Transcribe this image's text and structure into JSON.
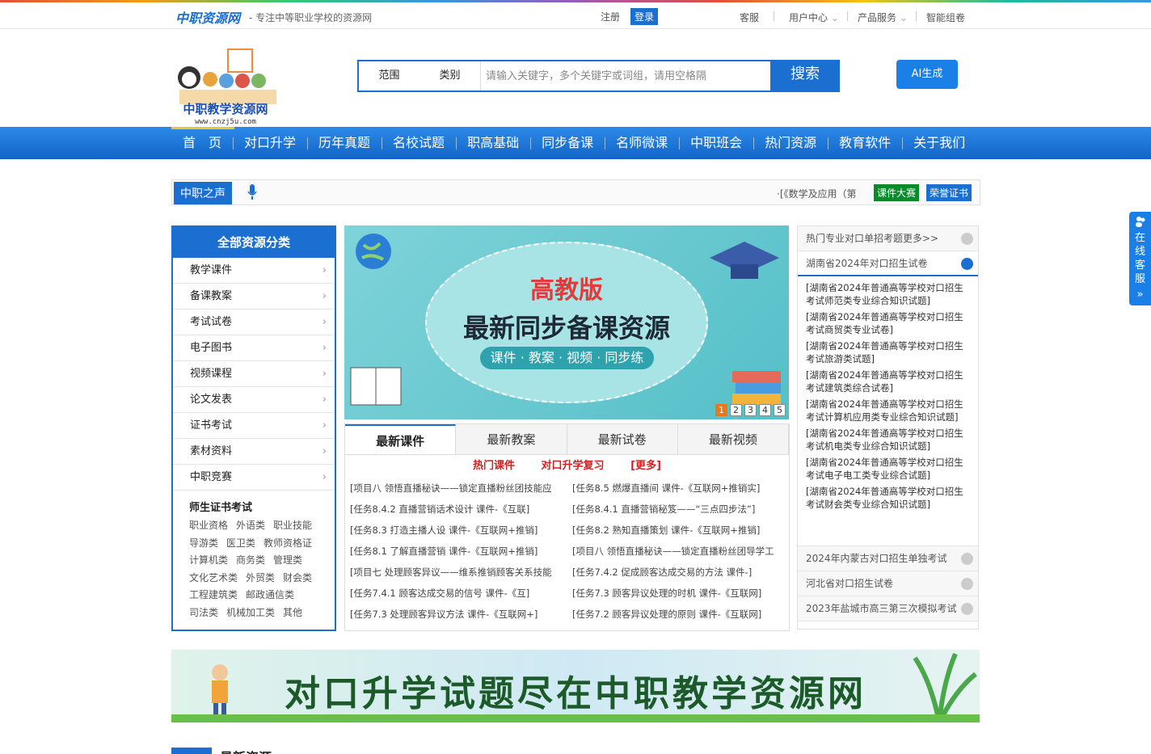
{
  "topbar": {
    "logo": "中职资源网",
    "slogan": "- 专注中等职业学校的资源网",
    "register": "注册",
    "login": "登录",
    "service": "客服",
    "user_center": "用户中心",
    "products": "产品服务",
    "smart_exam": "智能组卷"
  },
  "header": {
    "logo_text": "中职教学资源网",
    "logo_url": "www.cnzj5u.com",
    "scope": "范围",
    "category": "类别",
    "search_placeholder": "请输入关键字，多个关键字或词组，请用空格隔",
    "search_button": "搜索",
    "ai_button": "AI生成"
  },
  "nav": [
    "首　页",
    "对口升学",
    "历年真题",
    "名校试题",
    "职高基础",
    "同步备课",
    "名师微课",
    "中职班会",
    "热门资源",
    "教育软件",
    "关于我们"
  ],
  "voice": {
    "title": "中职之声",
    "ticker": "·[《数学及应用（第",
    "badge1": "课件大赛",
    "badge2": "荣誉证书"
  },
  "categories": {
    "title": "全部资源分类",
    "items": [
      "教学课件",
      "备课教案",
      "考试试卷",
      "电子图书",
      "视频课程",
      "论文发表",
      "证书考试",
      "素材资料",
      "中职竞赛"
    ],
    "sub_title": "师生证书考试",
    "sub_items": [
      "职业资格",
      "外语类",
      "职业技能",
      "导游类",
      "医卫类",
      "教师资格证",
      "计算机类",
      "商务类",
      "管理类",
      "文化艺术类",
      "外贸类",
      "财会类",
      "工程建筑类",
      "邮政通信类",
      "司法类",
      "机械加工类",
      "其他"
    ]
  },
  "banner": {
    "line1": "高教版",
    "line2": "最新同步备课资源",
    "line3": "课件 · 教案 · 视频 · 同步练",
    "pages": [
      "1",
      "2",
      "3",
      "4",
      "5"
    ]
  },
  "tabs": {
    "labels": [
      "最新课件",
      "最新教案",
      "最新试卷",
      "最新视频"
    ],
    "hot": [
      "热门课件",
      "对口升学复习",
      "[更多]"
    ],
    "items": [
      "[项目八 领悟直播秘诀——锁定直播粉丝团技能应",
      "[任务8.5 燃爆直播间 课件-《互联网+推销实]",
      "[任务8.4.2 直播营销话术设计 课件-《互联]",
      "[任务8.4.1 直播营销秘笈——“三点四步法”]",
      "[任务8.3 打造主播人设 课件-《互联网+推销]",
      "[任务8.2 熟知直播策划 课件-《互联网+推销]",
      "[任务8.1 了解直播营销 课件-《互联网+推销]",
      "[项目八 领悟直播秘诀——锁定直播粉丝团导学工",
      "[项目七 处理顾客异议——维系推销顾客关系技能",
      "[任务7.4.2 促成顾客达成交易的方法 课件-]",
      "[任务7.4.1 顾客达成交易的信号 课件-《互]",
      "[任务7.3 顾客异议处理的时机 课件-《互联网]",
      "[任务7.3 处理顾客异议方法 课件-《互联网+]",
      "[任务7.2 顾客异议处理的原则 课件-《互联网]"
    ]
  },
  "right_panel": {
    "head1": "热门专业对口单招考题更多>>",
    "head2": "湖南省2024年对口招生试卷",
    "items": [
      "[湖南省2024年普通高等学校对口招生考试师范类专业综合知识试题]",
      "[湖南省2024年普通高等学校对口招生考试商贸类专业试卷]",
      "[湖南省2024年普通高等学校对口招生考试旅游类试题]",
      "[湖南省2024年普通高等学校对口招生考试建筑类综合试卷]",
      "[湖南省2024年普通高等学校对口招生考试计算机应用类专业综合知识试题]",
      "[湖南省2024年普通高等学校对口招生考试机电类专业综合知识试题]",
      "[湖南省2024年普通高等学校对口招生考试电子电工类专业综合试题]",
      "[湖南省2024年普通高等学校对口招生考试财会类专业综合知识试题]"
    ],
    "more": [
      "2024年内蒙古对口招生单独考试",
      "河北省对口招生试卷",
      "2023年盐城市高三第三次模拟考试"
    ]
  },
  "promo": {
    "text": "对口升学试题尽在中职教学资源网"
  },
  "section": {
    "title": "最新资源"
  },
  "service_float": {
    "text": "在线客服"
  }
}
